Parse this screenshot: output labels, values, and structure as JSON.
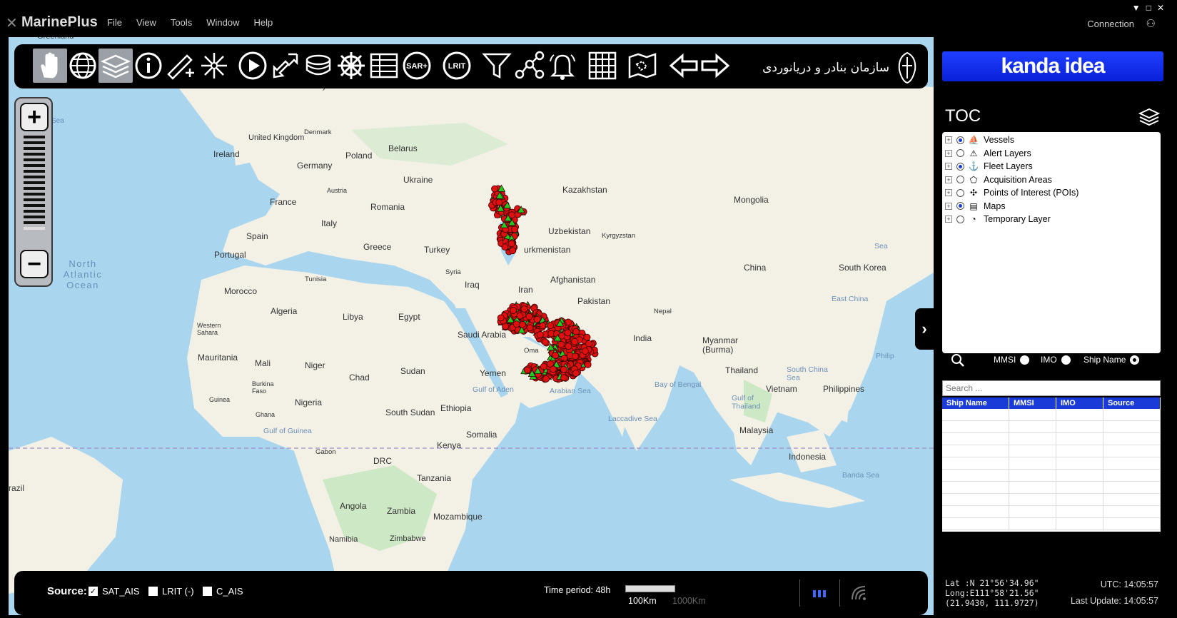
{
  "app": {
    "title": "MarinePlus",
    "menu": [
      "File",
      "View",
      "Tools",
      "Window",
      "Help"
    ],
    "connection_label": "Connection",
    "window_controls": [
      "▼",
      "□",
      "✕"
    ]
  },
  "toolbar": {
    "tools": [
      "hand-pan",
      "globe",
      "layers",
      "info",
      "measure",
      "center",
      "play",
      "arrows",
      "coins",
      "helm",
      "table",
      "SAR+",
      "LRIT",
      "filter",
      "network",
      "alarm",
      "grid",
      "map-area",
      "back",
      "forward"
    ],
    "sar_label": "SAR+",
    "lrit_label": "LRIT",
    "org_logo_text": "سازمان بنادر و دریانوردی"
  },
  "brand": {
    "text": "kanda idea"
  },
  "toc": {
    "title": "TOC",
    "layers": [
      {
        "label": "Vessels",
        "selected": true,
        "icon": "ship-icon"
      },
      {
        "label": "Alert Layers",
        "selected": false,
        "icon": "alert-icon"
      },
      {
        "label": "Fleet Layers",
        "selected": true,
        "icon": "fleet-icon"
      },
      {
        "label": "Acquisition Areas",
        "selected": false,
        "icon": "polygon-icon"
      },
      {
        "label": "Points of Interest (POIs)",
        "selected": false,
        "icon": "poi-icon"
      },
      {
        "label": "Maps",
        "selected": true,
        "icon": "maps-icon"
      },
      {
        "label": "Temporary Layer",
        "selected": false,
        "icon": "temp-icon"
      }
    ],
    "search_options": {
      "mmsi": "MMSI",
      "imo": "IMO",
      "ship_name": "Ship Name"
    },
    "search_placeholder": "Search ...",
    "columns": [
      "Ship Name",
      "MMSI",
      "IMO",
      "Source"
    ]
  },
  "map_labels": {
    "greenland": "Greenland",
    "norway": "Norway",
    "united_kingdom": "United Kingdom",
    "ireland": "Ireland",
    "denmark": "Denmark",
    "poland": "Poland",
    "belarus": "Belarus",
    "germany": "Germany",
    "ukraine": "Ukraine",
    "austria": "Austria",
    "france": "France",
    "romania": "Romania",
    "italy": "Italy",
    "spain": "Spain",
    "portugal": "Portugal",
    "greece": "Greece",
    "turkey": "Turkey",
    "kazakhstan": "Kazakhstan",
    "mongolia": "Mongolia",
    "uzbekistan": "Uzbekistan",
    "kyrgyzstan": "Kyrgyzstan",
    "turkmenistan": "urkmenistan",
    "north_atlantic": "North Atlantic Ocean",
    "tunisia": "Tunisia",
    "syria": "Syria",
    "iraq": "Iraq",
    "iran": "Iran",
    "afghanistan": "Afghanistan",
    "china": "China",
    "south_korea": "South Korea",
    "morocco": "Morocco",
    "algeria": "Algeria",
    "libya": "Libya",
    "egypt": "Egypt",
    "pakistan": "Pakistan",
    "nepal": "Nepal",
    "east_china_sea": "East China",
    "western_sahara": "Western Sahara",
    "saudi_arabia": "Saudi Arabia",
    "india": "India",
    "oman": "Oma",
    "myanmar": "Myanmar (Burma)",
    "mauritania": "Mauritania",
    "mali": "Mali",
    "niger": "Niger",
    "chad": "Chad",
    "sudan": "Sudan",
    "yemen": "Yemen",
    "thailand": "Thailand",
    "bay_of_bengal": "Bay of Bengal",
    "south_china_sea": "South China Sea",
    "vietnam": "Vietnam",
    "philippines": "Philippines",
    "gulf_of_aden": "Gulf of Aden",
    "arabian_sea": "Arabian Sea",
    "burkina": "Burkina Faso",
    "guinea": "Guinea",
    "ghana": "Ghana",
    "nigeria": "Nigeria",
    "south_sudan": "South Sudan",
    "ethiopia": "Ethiopia",
    "gulf_of_thailand": "Gulf of Thailand",
    "laccadive": "Laccadive Sea",
    "gulf_of_guinea": "Gulf of Guinea",
    "somalia": "Somalia",
    "malaysia": "Malaysia",
    "kenya": "Kenya",
    "gabon": "Gabon",
    "drc": "DRC",
    "indonesia": "Indonesia",
    "tanzania": "Tanzania",
    "banda_sea": "Banda Sea",
    "angola": "Angola",
    "zambia": "Zambia",
    "mozambique": "Mozambique",
    "namibia": "Namibia",
    "zimbabwe": "Zimbabwe",
    "brazil": "razil",
    "sea": "Sea",
    "philip": "Philip",
    "sea2": "Sea"
  },
  "bottom": {
    "source_label": "Source:",
    "sources": [
      {
        "label": "SAT_AIS",
        "checked": true
      },
      {
        "label": "LRIT (-)",
        "checked": false
      },
      {
        "label": "C_AIS",
        "checked": false
      }
    ],
    "time_period": "Time period: 48h",
    "scale_100": "100Km",
    "scale_1000": "1000Km"
  },
  "status": {
    "lat": "Lat  :N 21°56'34.96\"",
    "long": "Long:E111°58'21.56\"",
    "decimal": "(21.9430, 111.9727)",
    "utc": "UTC: 14:05:57",
    "last_update": "Last Update: 14:05:57"
  },
  "colors": {
    "brand_blue": "#1a3bd8",
    "vessel_red": "#e01010",
    "vessel_green": "#22cc22",
    "land": "#f3f1e6",
    "water": "#a9d6ee"
  }
}
